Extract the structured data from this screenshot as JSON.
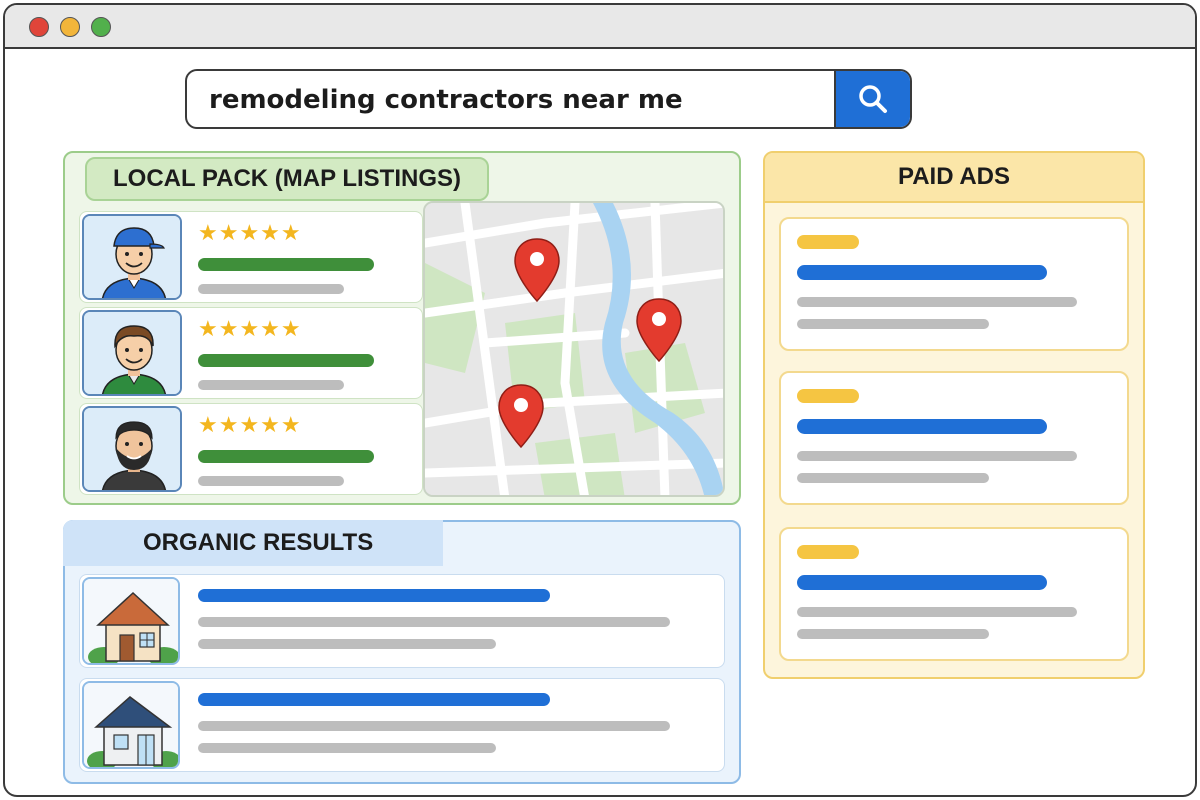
{
  "browser": {
    "controls": [
      "close",
      "minimize",
      "maximize"
    ]
  },
  "search": {
    "query": "remodeling contractors near me",
    "button_icon": "search-icon"
  },
  "local_pack": {
    "label": "LOCAL PACK (MAP LISTINGS)",
    "listings": [
      {
        "avatar_icon": "contractor-avatar-cap-icon",
        "stars": "★★★★★",
        "rating": 5
      },
      {
        "avatar_icon": "contractor-avatar-icon",
        "stars": "★★★★★",
        "rating": 5
      },
      {
        "avatar_icon": "contractor-avatar-beard-icon",
        "stars": "★★★★★",
        "rating": 5
      }
    ],
    "map_pins": 3
  },
  "organic": {
    "label": "ORGANIC RESULTS",
    "results": [
      {
        "thumbnail_icon": "house-icon"
      },
      {
        "thumbnail_icon": "house-icon"
      }
    ]
  },
  "paid_ads": {
    "label": "PAID ADS",
    "ads": [
      {},
      {},
      {}
    ]
  },
  "colors": {
    "local_accent": "#9ccc8a",
    "organic_accent": "#8ebbe6",
    "ads_accent": "#f0cf6e",
    "link_blue": "#1f6fd6",
    "pin_red": "#e33b2e",
    "star_gold": "#f3b61f"
  }
}
